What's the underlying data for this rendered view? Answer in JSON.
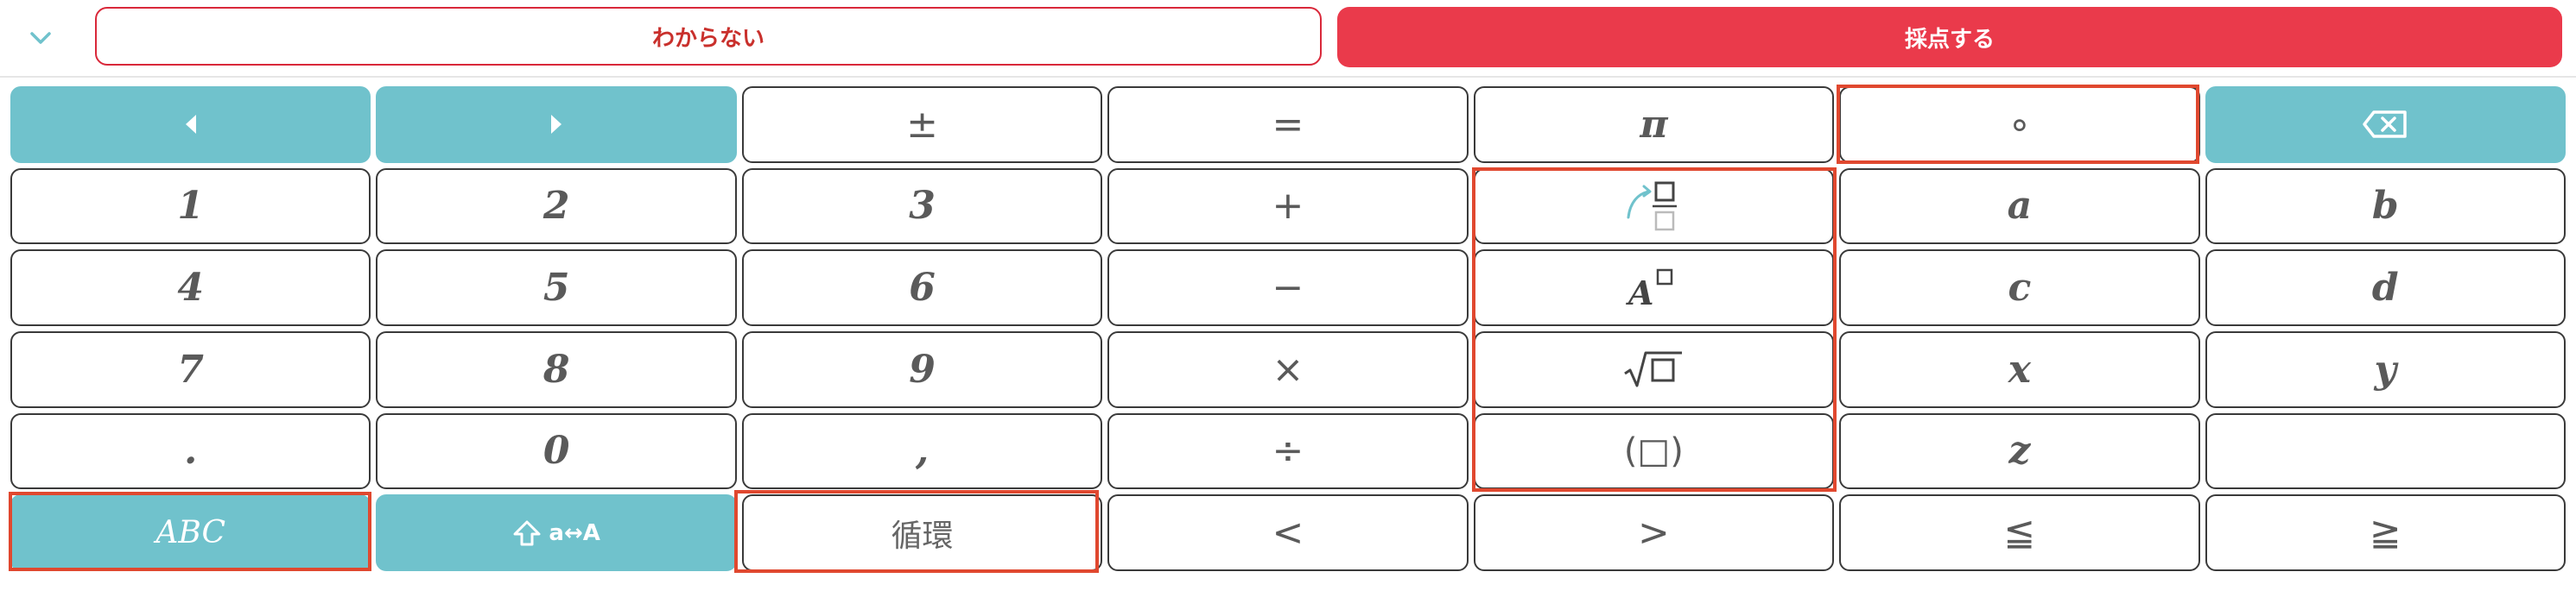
{
  "header": {
    "collapse_icon": "chevron-down-icon",
    "unknown_label": "わからない",
    "grade_label": "採点する"
  },
  "keys": {
    "cursor_left": "◀",
    "cursor_right": "▶",
    "plus_minus": "±",
    "equals": "=",
    "pi": "π",
    "degree": "∘",
    "backspace_icon": "backspace-icon",
    "n1": "1",
    "n2": "2",
    "n3": "3",
    "plus": "+",
    "fraction_icon": "fraction-icon",
    "a": "a",
    "b": "b",
    "n4": "4",
    "n5": "5",
    "n6": "6",
    "minus": "−",
    "power_icon": "power-icon",
    "c": "c",
    "d": "d",
    "n7": "7",
    "n8": "8",
    "n9": "9",
    "times": "×",
    "sqrt_icon": "sqrt-icon",
    "x": "x",
    "y": "y",
    "dot": ".",
    "n0": "0",
    "comma": ",",
    "divide": "÷",
    "paren": "(□)",
    "z": "z",
    "empty": "",
    "abc": "ABC",
    "shift": "a↔A",
    "recurring": "循環",
    "lt": "<",
    "gt": ">",
    "le": "≦",
    "ge": "≧"
  },
  "colors": {
    "accent_teal": "#70c2cc",
    "grade_red": "#ea3a4b",
    "highlight_outline": "#e0482f"
  }
}
